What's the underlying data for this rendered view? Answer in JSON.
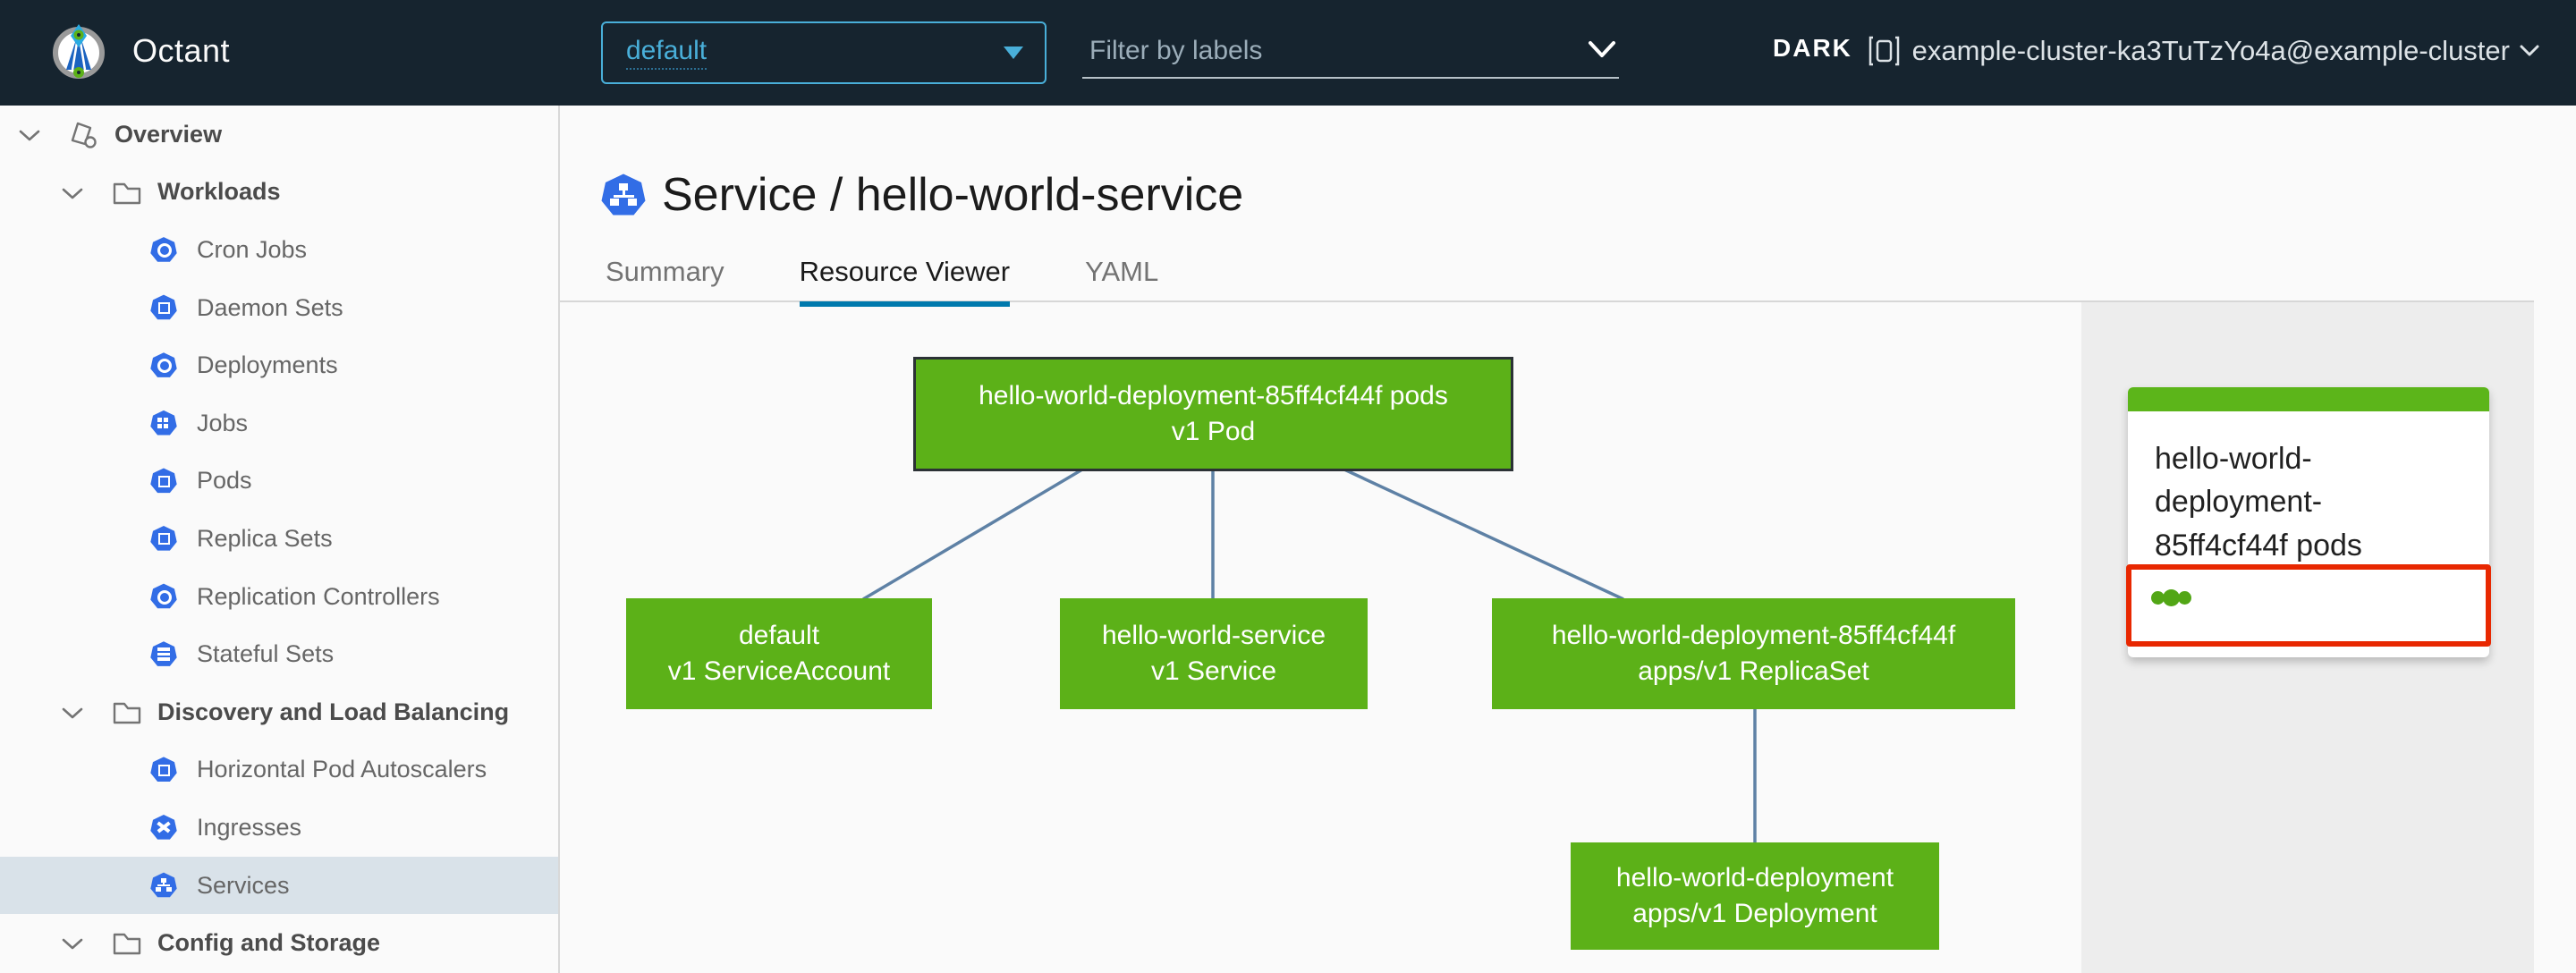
{
  "colors": {
    "header_bg": "#16242f",
    "accent_blue": "#49afd9",
    "tab_active_underline": "#0079ad",
    "k8s_icon_blue": "#326de6",
    "node_green": "#5cb118",
    "edge_blue": "#5e81a5",
    "selection_red": "#e82801",
    "sidebar_selected_bg": "#d9e2e9",
    "panel_bg": "#ededed",
    "pod_status_dot_green": "#52a616"
  },
  "header": {
    "app_title": "Octant",
    "namespace_selector": {
      "value": "default"
    },
    "label_filter": {
      "placeholder": "Filter by labels"
    },
    "theme_toggle": {
      "label": "DARK",
      "icon": "moon-icon"
    },
    "cluster_selector": {
      "name": "example-cluster-ka3TuTzYo4a@example-cluster",
      "icon": "cluster-icon"
    }
  },
  "sidebar": {
    "items": [
      {
        "label": "Overview",
        "level": 0,
        "icon": "applications-icon",
        "expanded": true
      },
      {
        "label": "Workloads",
        "level": 1,
        "icon": "folder-icon",
        "expanded": true
      },
      {
        "label": "Cron Jobs",
        "level": 2,
        "icon": "cron-jobs-icon"
      },
      {
        "label": "Daemon Sets",
        "level": 2,
        "icon": "daemon-sets-icon"
      },
      {
        "label": "Deployments",
        "level": 2,
        "icon": "deployments-icon"
      },
      {
        "label": "Jobs",
        "level": 2,
        "icon": "jobs-icon"
      },
      {
        "label": "Pods",
        "level": 2,
        "icon": "pods-icon"
      },
      {
        "label": "Replica Sets",
        "level": 2,
        "icon": "replica-sets-icon"
      },
      {
        "label": "Replication Controllers",
        "level": 2,
        "icon": "replication-controllers-icon"
      },
      {
        "label": "Stateful Sets",
        "level": 2,
        "icon": "stateful-sets-icon"
      },
      {
        "label": "Discovery and Load Balancing",
        "level": 1,
        "icon": "folder-icon",
        "expanded": true
      },
      {
        "label": "Horizontal Pod Autoscalers",
        "level": 2,
        "icon": "hpa-icon"
      },
      {
        "label": "Ingresses",
        "level": 2,
        "icon": "ingresses-icon"
      },
      {
        "label": "Services",
        "level": 2,
        "icon": "services-icon",
        "selected": true
      },
      {
        "label": "Config and Storage",
        "level": 1,
        "icon": "folder-icon",
        "expanded": true
      }
    ]
  },
  "main": {
    "page_title": "Service / hello-world-service",
    "page_title_icon": "service-icon",
    "tabs": [
      {
        "label": "Summary",
        "active": false
      },
      {
        "label": "Resource Viewer",
        "active": true
      },
      {
        "label": "YAML",
        "active": false
      }
    ],
    "graph": {
      "nodes": [
        {
          "id": "pod",
          "name": "hello-world-deployment-85ff4cf44f pods",
          "kind": "v1 Pod",
          "selected": true,
          "status": "ok"
        },
        {
          "id": "serviceaccount",
          "name": "default",
          "kind": "v1 ServiceAccount",
          "status": "ok"
        },
        {
          "id": "service",
          "name": "hello-world-service",
          "kind": "v1 Service",
          "status": "ok"
        },
        {
          "id": "replicaset",
          "name": "hello-world-deployment-85ff4cf44f",
          "kind": "apps/v1 ReplicaSet",
          "status": "ok"
        },
        {
          "id": "deployment",
          "name": "hello-world-deployment",
          "kind": "apps/v1 Deployment",
          "status": "ok"
        }
      ],
      "edges": [
        [
          "pod",
          "serviceaccount"
        ],
        [
          "pod",
          "service"
        ],
        [
          "pod",
          "replicaset"
        ],
        [
          "replicaset",
          "deployment"
        ]
      ]
    },
    "detail_panel": {
      "card_title": "hello-world-deployment-85ff4cf44f pods",
      "pod_status": {
        "dot_count": 3,
        "highlighted": true
      }
    }
  }
}
